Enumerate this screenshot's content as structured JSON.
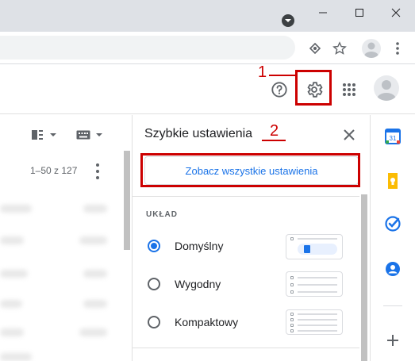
{
  "browser": {
    "window_controls": [
      "minimize-icon",
      "maximize-icon",
      "close-icon"
    ]
  },
  "gmail_header": {
    "icons": [
      "help-icon",
      "settings-gear-icon",
      "apps-grid-icon",
      "account-avatar"
    ]
  },
  "list": {
    "pager_text": "1–50 z 127"
  },
  "quick_settings": {
    "title": "Szybkie ustawienia",
    "see_all_label": "Zobacz wszystkie ustawienia",
    "layout_section_label": "UKŁAD",
    "layout_options": [
      {
        "label": "Domyślny",
        "selected": true
      },
      {
        "label": "Wygodny",
        "selected": false
      },
      {
        "label": "Kompaktowy",
        "selected": false
      }
    ]
  },
  "side_panel": {
    "apps": [
      {
        "name": "calendar-icon",
        "text": "31",
        "color": "#1a73e8"
      },
      {
        "name": "keep-icon",
        "color": "#fbbc04"
      },
      {
        "name": "tasks-icon",
        "color": "#1a73e8"
      },
      {
        "name": "contacts-icon",
        "color": "#1a73e8"
      },
      {
        "name": "add-icon"
      }
    ]
  },
  "annotations": {
    "step1": "1",
    "step2": "2",
    "color": "#cc0000"
  },
  "colors": {
    "accent": "#1a73e8",
    "titlebar": "#dee1e6"
  }
}
